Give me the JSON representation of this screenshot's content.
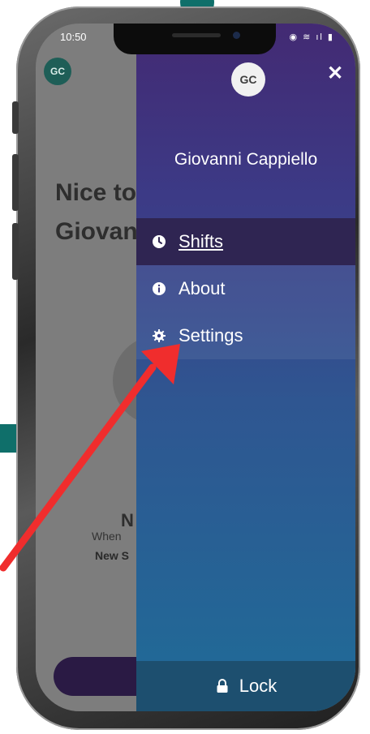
{
  "status_bar": {
    "time": "10:50",
    "icons": "◉ ≋ ıl ▮"
  },
  "background_app": {
    "avatar_initials": "GC",
    "greeting_line1": "Nice to",
    "greeting_line2": "Giovan",
    "empty_title": "N",
    "empty_text": "When",
    "empty_bold": "New S"
  },
  "drawer": {
    "avatar_initials": "GC",
    "close_icon": "close-icon",
    "user_name": "Giovanni Cappiello",
    "menu": [
      {
        "label": "Shifts",
        "icon": "clock-icon",
        "active": true
      },
      {
        "label": "About",
        "icon": "info-icon",
        "active": false
      },
      {
        "label": "Settings",
        "icon": "gear-icon",
        "active": false
      }
    ],
    "lock_label": "Lock",
    "lock_icon": "lock-icon"
  },
  "colors": {
    "accent_teal": "#0f6f6a",
    "annotation_arrow": "#f02d2d",
    "drawer_top": "#432a73",
    "drawer_bottom": "#1f6c98"
  }
}
